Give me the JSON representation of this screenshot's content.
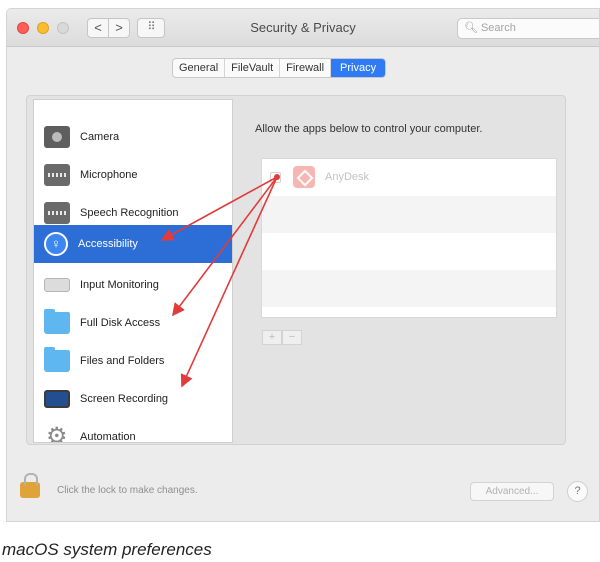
{
  "window": {
    "title": "Security & Privacy",
    "search_placeholder": "Search",
    "nav": {
      "back": "<",
      "forward": ">",
      "grid": "⠿"
    }
  },
  "tabs": [
    {
      "label": "General",
      "active": false
    },
    {
      "label": "FileVault",
      "active": false
    },
    {
      "label": "Firewall",
      "active": false
    },
    {
      "label": "Privacy",
      "active": true
    }
  ],
  "sidebar": {
    "items": [
      {
        "label": "Camera",
        "icon": "camera-icon",
        "selected": false
      },
      {
        "label": "Microphone",
        "icon": "microphone-icon",
        "selected": false
      },
      {
        "label": "Speech Recognition",
        "icon": "speech-icon",
        "selected": false
      },
      {
        "label": "Accessibility",
        "icon": "accessibility-icon",
        "selected": true
      },
      {
        "label": "Input Monitoring",
        "icon": "keyboard-icon",
        "selected": false
      },
      {
        "label": "Full Disk Access",
        "icon": "folder-icon",
        "selected": false
      },
      {
        "label": "Files and Folders",
        "icon": "folder-icon",
        "selected": false
      },
      {
        "label": "Screen Recording",
        "icon": "display-icon",
        "selected": false
      },
      {
        "label": "Automation",
        "icon": "gear-icon",
        "selected": false
      }
    ]
  },
  "main": {
    "description": "Allow the apps below to control your computer.",
    "apps": [
      {
        "name": "AnyDesk",
        "checked": false,
        "icon": "anydesk-icon"
      }
    ],
    "add_label": "+",
    "remove_label": "−"
  },
  "footer": {
    "lock_text": "Click the lock to make changes.",
    "advanced_label": "Advanced...",
    "help_label": "?"
  },
  "caption": "macOS system preferences",
  "colors": {
    "accent": "#2f7bf6",
    "selection": "#2d6ed6",
    "annotation_arrow": "#e23b3b"
  }
}
